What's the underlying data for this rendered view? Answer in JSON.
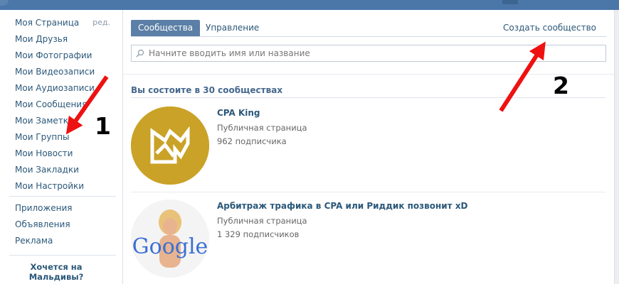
{
  "sidebar": {
    "items": [
      {
        "label": "Моя Страница",
        "edit": "ред."
      },
      {
        "label": "Мои Друзья"
      },
      {
        "label": "Мои Фотографии"
      },
      {
        "label": "Мои Видеозаписи"
      },
      {
        "label": "Мои Аудиозаписи"
      },
      {
        "label": "Мои Сообщения"
      },
      {
        "label": "Мои Заметки"
      },
      {
        "label": "Мои Группы"
      },
      {
        "label": "Мои Новости"
      },
      {
        "label": "Мои Закладки"
      },
      {
        "label": "Мои Настройки"
      }
    ],
    "extra_items": [
      {
        "label": "Приложения"
      },
      {
        "label": "Объявления"
      },
      {
        "label": "Реклама"
      }
    ],
    "promo": "Хочется на Мальдивы?"
  },
  "tabs": {
    "communities": "Сообщества",
    "management": "Управление",
    "create": "Создать сообщество"
  },
  "search": {
    "placeholder": "Начните вводить имя или название",
    "icon": "search-icon"
  },
  "section": {
    "title": "Вы состоите в 30 сообществах"
  },
  "groups": [
    {
      "name": "CPA King",
      "type": "Публичная страница",
      "subscribers": "962 подписчика",
      "avatar_color": "#c9a227"
    },
    {
      "name": "Арбитраж трафика в CPA или Риддик позвонит xD",
      "type": "Публичная страница",
      "subscribers": "1 329 подписчиков",
      "avatar_text": "Google"
    }
  ],
  "annotations": {
    "label_1": "1",
    "label_2": "2",
    "arrow_color": "#ee1111"
  },
  "colors": {
    "header": "#4a76a8",
    "link": "#2b587a",
    "active_tab": "#5b7fa6"
  }
}
